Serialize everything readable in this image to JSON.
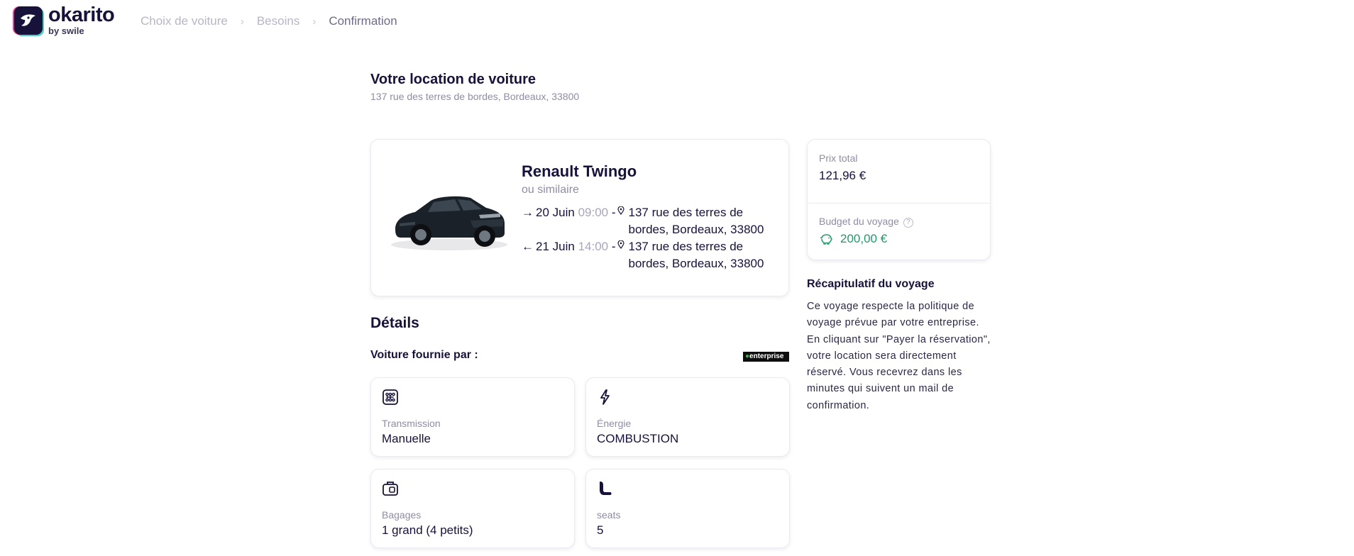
{
  "brand": {
    "name": "okarito",
    "sub": "by swile"
  },
  "breadcrumb": [
    {
      "label": "Choix de voiture",
      "active": false
    },
    {
      "label": "Besoins",
      "active": false
    },
    {
      "label": "Confirmation",
      "active": true
    }
  ],
  "breadcrumb_separator": "›",
  "page": {
    "title": "Votre location de voiture",
    "subtitle": "137 rue des terres de bordes, Bordeaux, 33800"
  },
  "car": {
    "name": "Renault Twingo",
    "similar": "ou similaire",
    "pickup": {
      "arrow": "→",
      "date": "20 Juin",
      "time": "09:00",
      "dash": "-",
      "address_line1": "137 rue des terres de",
      "address_line2": "bordes, Bordeaux, 33800"
    },
    "dropoff": {
      "arrow": "←",
      "date": "21 Juin",
      "time": "14:00",
      "dash": "-",
      "address_line1": "137 rue des terres de",
      "address_line2": "bordes, Bordeaux, 33800"
    }
  },
  "price": {
    "total_label": "Prix total",
    "total_value": "121,96 €",
    "budget_label": "Budget du voyage",
    "budget_help": "?",
    "budget_value": "200,00 €"
  },
  "recap": {
    "title": "Récapitulatif du voyage",
    "text": "Ce voyage respecte la politique de voyage prévue par votre entreprise. En cliquant sur \"Payer la réservation\", votre location sera directement réservé. Vous recevrez dans les minutes qui suivent un mail de confirmation."
  },
  "details": {
    "title": "Détails",
    "provider_label": "Voiture fournie par :",
    "provider_logo_text": "enterprise"
  },
  "features": [
    {
      "icon": "gearbox-icon",
      "label": "Transmission",
      "value": "Manuelle"
    },
    {
      "icon": "lightning-icon",
      "label": "Énergie",
      "value": "COMBUSTION"
    },
    {
      "icon": "luggage-icon",
      "label": "Bagages",
      "value": "1 grand (4 petits)"
    },
    {
      "icon": "seat-icon",
      "label": "seats",
      "value": "5"
    }
  ],
  "colors": {
    "primary": "#16123a",
    "muted": "#8f8ca3",
    "success": "#1f9a6a"
  }
}
